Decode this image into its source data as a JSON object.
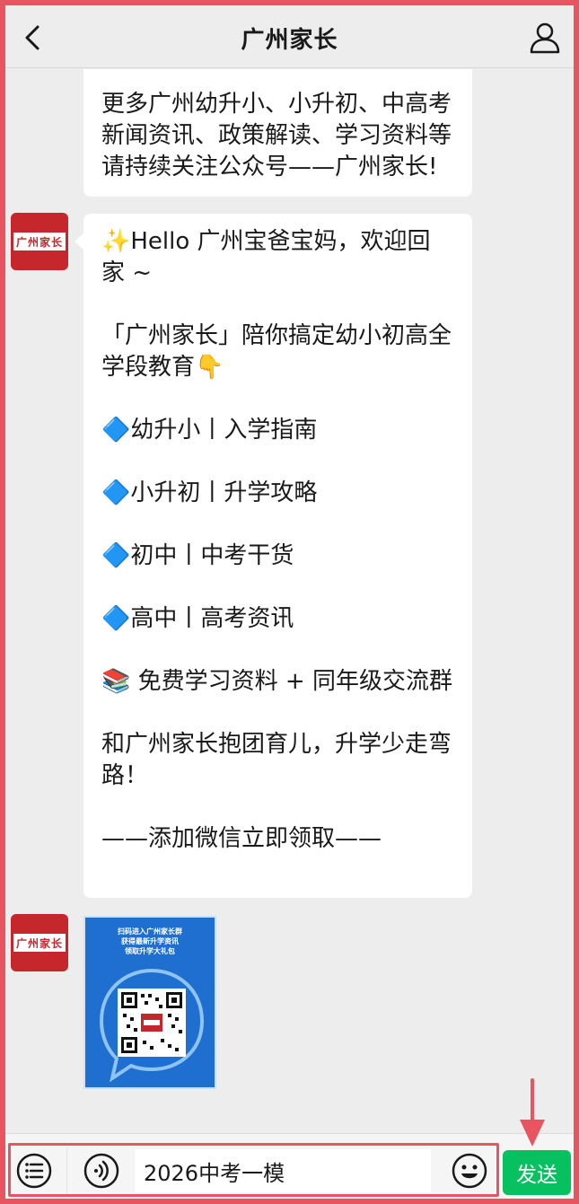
{
  "header": {
    "title": "广州家长"
  },
  "messages": {
    "first_lines": [
      "更多广州幼升小、小升初、中高考",
      "新闻资讯、政策解读、学习资料等",
      "请持续关注公众号——广州家长!"
    ],
    "welcome": {
      "greeting_line1": "✨Hello 广州宝爸宝妈，欢迎回",
      "greeting_line2": "家 ~",
      "intro_line1": "「广州家长」陪你搞定幼小初高全",
      "intro_line2": "学段教育👇",
      "item1": "🔷幼升小丨入学指南",
      "item2": "🔷小升初丨升学攻略",
      "item3": "🔷初中丨中考干货",
      "item4": "🔷高中丨高考资讯",
      "item5": "📚 免费学习资料 + 同年级交流群",
      "closing_line1": "和广州家长抱团育儿，升学少走弯",
      "closing_line2": "路！",
      "cta": "——添加微信立即领取——"
    },
    "avatar_label": "广州家长",
    "qr_card": {
      "line1": "扫码进入广州家长群",
      "line2": "获得最新升学资讯",
      "line3": "领取升学大礼包"
    }
  },
  "input": {
    "value": "2026中考一模"
  },
  "send_label": "发送",
  "colors": {
    "accent_green": "#07c160",
    "highlight_red": "#e8545f",
    "avatar_red": "#c5272d",
    "qr_blue": "#1e6fd0"
  },
  "icons": [
    "back-arrow-icon",
    "profile-icon",
    "menu-list-icon",
    "voice-icon",
    "emoji-icon",
    "down-arrow-icon"
  ]
}
